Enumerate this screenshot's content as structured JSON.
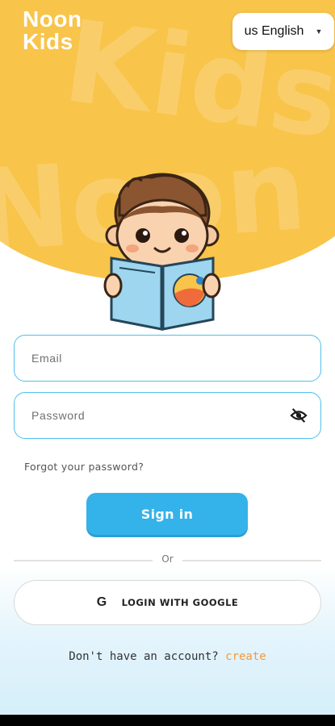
{
  "brand": {
    "line1": "Noon",
    "line2": "Kids"
  },
  "language": {
    "label": "us English"
  },
  "hero": {
    "watermark1": "Kids",
    "watermark2": "Noon"
  },
  "form": {
    "email_placeholder": "Email",
    "email_value": "",
    "password_placeholder": "Password",
    "password_value": "",
    "forgot_label": "Forgot your password?",
    "signin_label": "Sign in",
    "divider_label": "Or",
    "google_icon": "G",
    "google_label": "LOGIN  WITH GOOGLE"
  },
  "signup": {
    "prompt": "Don't have an account?",
    "link": "create"
  },
  "colors": {
    "hero": "#f8c44a",
    "accent": "#34b2ea",
    "link": "#f39a3a",
    "field_border": "#4fc0ec"
  }
}
